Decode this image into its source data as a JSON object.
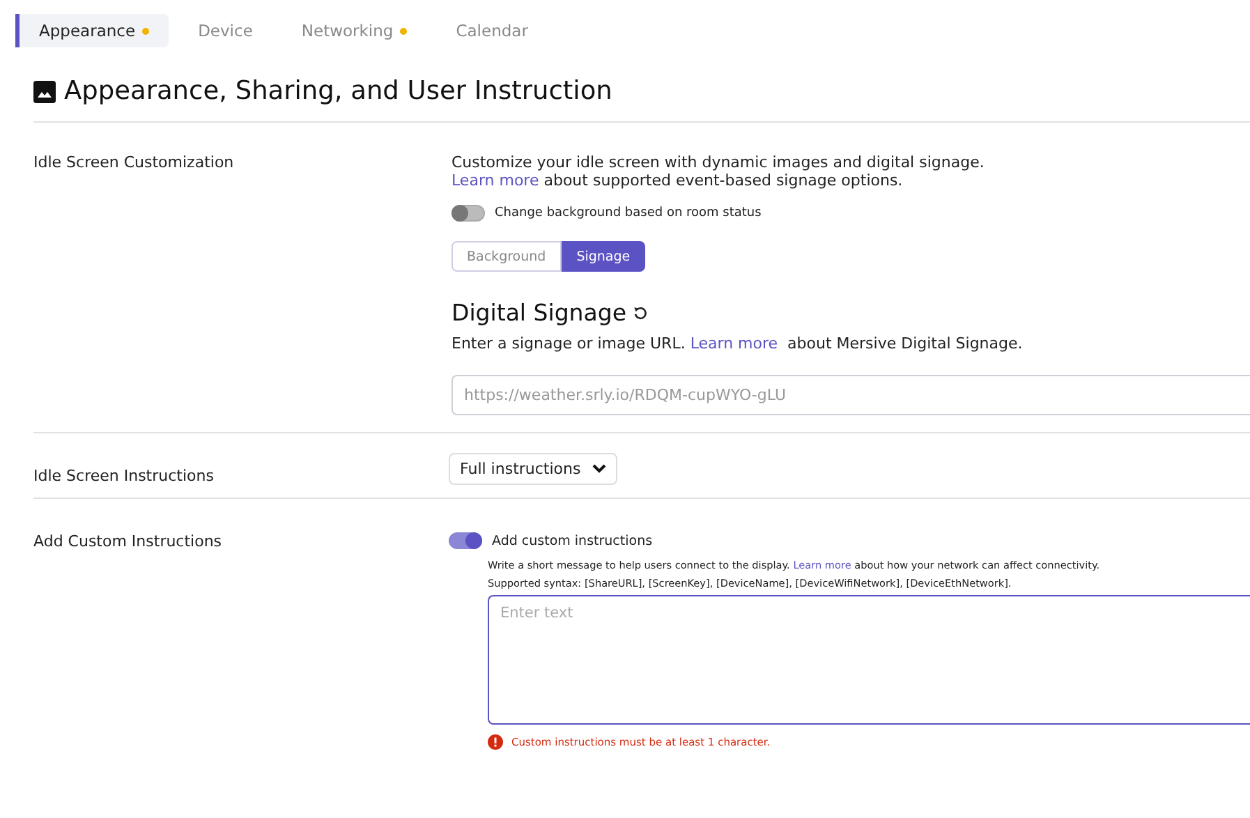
{
  "tabs": [
    {
      "label": "Appearance",
      "selected": true,
      "modified": true
    },
    {
      "label": "Device",
      "selected": false,
      "modified": false
    },
    {
      "label": "Networking",
      "selected": false,
      "modified": true
    },
    {
      "label": "Calendar",
      "selected": false,
      "modified": false
    }
  ],
  "page_title": "Appearance, Sharing, and User Instruction",
  "sections": [
    {
      "kind": "signage",
      "label": "Idle Screen Customization",
      "intro": [
        [
          {
            "kind": "text",
            "text": "Customize your idle screen with dynamic images and digital signage."
          }
        ],
        [
          {
            "kind": "link",
            "text": "Learn more"
          },
          {
            "kind": "text",
            "text": " about supported event-based signage options."
          }
        ]
      ],
      "toggle": {
        "label": "Change background based on room status",
        "on": false
      },
      "segments": [
        {
          "label": "Background",
          "selected": false
        },
        {
          "label": "Signage",
          "selected": true
        }
      ],
      "heading": "Digital Signage",
      "description": [
        {
          "kind": "text",
          "text": "Enter a signage or image URL. "
        },
        {
          "kind": "link",
          "text": "Learn more"
        },
        {
          "kind": "text",
          "text": "  about Mersive Digital Signage."
        }
      ],
      "url_field": {
        "placeholder": "https://weather.srly.io/RDQM-cupWYO-gLU"
      }
    },
    {
      "kind": "select",
      "label": "Idle Screen Instructions",
      "value": "Full instructions"
    },
    {
      "kind": "custom",
      "label": "Add Custom Instructions",
      "toggle": {
        "label": "Add custom instructions",
        "on": true
      },
      "help": [
        [
          {
            "kind": "text",
            "text": "Write a short message to help users connect to the display. "
          },
          {
            "kind": "link",
            "text": "Learn more"
          },
          {
            "kind": "text",
            "text": " about how your network can affect connectivity."
          }
        ],
        [
          {
            "kind": "text",
            "text": "Supported syntax: [ShareURL], [ScreenKey], [DeviceName], [DeviceWifiNetwork], [DeviceEthNetwork]."
          }
        ]
      ],
      "text_area": {
        "placeholder": "Enter text"
      },
      "error": "Custom instructions must be at least 1 character."
    }
  ]
}
